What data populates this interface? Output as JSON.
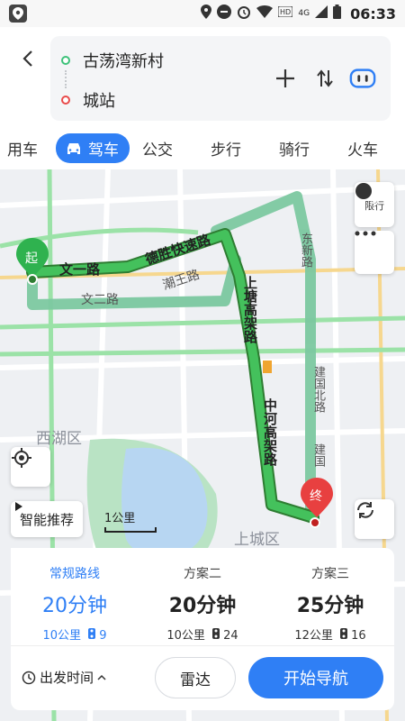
{
  "status_bar": {
    "signal": "4G",
    "time": "06:33"
  },
  "route": {
    "origin": "古荡湾新村",
    "destination": "城站"
  },
  "tabs": [
    {
      "label": "用车"
    },
    {
      "label": "驾车"
    },
    {
      "label": "公交"
    },
    {
      "label": "步行"
    },
    {
      "label": "骑行"
    },
    {
      "label": "火车"
    }
  ],
  "map": {
    "limit_label": "限行",
    "limit_icon_text": "限",
    "start_marker": "起",
    "end_marker": "终",
    "smart_recommend": "智能推荐",
    "scale": "1公里",
    "districts": [
      "西湖区",
      "上城区"
    ],
    "roads": {
      "wenyi": "文一路",
      "deshen": "德胜快速路",
      "wener": "文二路",
      "chaowang": "潮王路",
      "shangtang": "上塘高架路",
      "zhonghe": "中河高架路",
      "dongxin": "东新路",
      "jianguo": "建国北路",
      "jianguo2": "建国"
    }
  },
  "plans": [
    {
      "name": "常规路线",
      "duration": "20分钟",
      "distance": "10公里",
      "lights": "9"
    },
    {
      "name": "方案二",
      "duration": "20分钟",
      "distance": "10公里",
      "lights": "24"
    },
    {
      "name": "方案三",
      "duration": "25分钟",
      "distance": "12公里",
      "lights": "16"
    }
  ],
  "actions": {
    "depart_time": "出发时间",
    "radar": "雷达",
    "start_nav": "开始导航"
  },
  "colors": {
    "accent": "#2f7ff5",
    "route_green": "#35b353",
    "route_alt": "#7cc8a0",
    "start_green": "#2fb24f",
    "end_red": "#e84040"
  }
}
